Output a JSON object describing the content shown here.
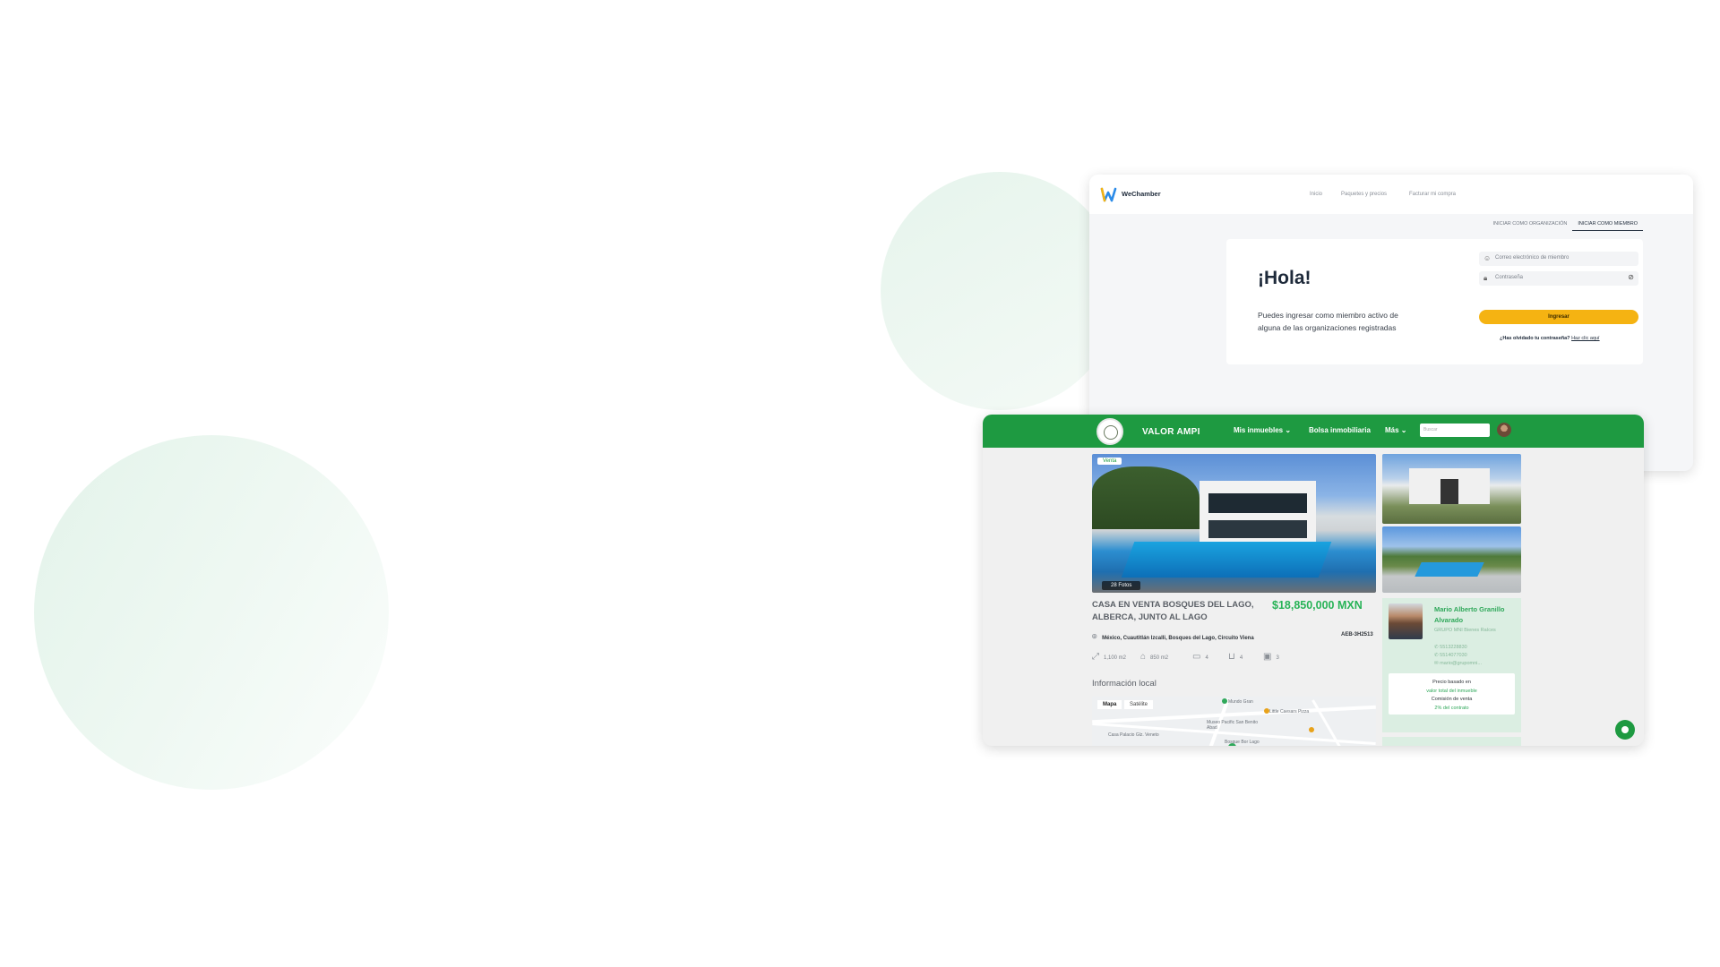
{
  "wechamber": {
    "brand": "WeChamber",
    "nav": [
      "Inicio",
      "Paquetes y precios",
      "Facturar mi compra"
    ],
    "tabs": [
      "INICIAR COMO ORGANIZACIÓN",
      "INICIAR COMO MIEMBRO"
    ],
    "active_tab": "INICIAR COMO MIEMBRO",
    "greeting": "¡Hola!",
    "description": "Puedes ingresar como miembro activo de alguna de las organizaciones registradas",
    "email_placeholder": "Correo electrónico de miembro",
    "password_placeholder": "Contraseña",
    "login_button": "Ingresar",
    "forgot_text": "¿Has olvidado tu contraseña?",
    "forgot_link": "Haz clic aquí",
    "colors": {
      "accent": "#f5b312",
      "text": "#1e2a3a"
    }
  },
  "valor": {
    "brand": "VALOR AMPI",
    "nav": {
      "mis_inmuebles": "Mis inmuebles",
      "bolsa": "Bolsa inmobiliaria",
      "mas": "Más"
    },
    "search_placeholder": "Buscar",
    "listing": {
      "tag": "Venta",
      "photo_count": "28 Fotos",
      "title": "CASA EN VENTA BOSQUES DEL LAGO, ALBERCA, JUNTO AL LAGO",
      "price": "$18,850,000 MXN",
      "location": "México, Cuautitlán Izcalli, Bosques del Lago, Circuito Viena",
      "code": "AEB-3H2513",
      "features": [
        "1,100 m2",
        "850 m2",
        "4",
        "4",
        "3"
      ]
    },
    "info_heading": "Información local",
    "map": {
      "tabs": [
        "Mapa",
        "Satélite"
      ],
      "labels": [
        "Mundo Gran",
        "Little Caesars Pizza",
        "Museo Pacific San Benito Abad",
        "Casa Palacio Glz. Veneto",
        "Bosque Bor Lago"
      ]
    },
    "agent": {
      "name": "Mario Alberto Granillo Alvarado",
      "org": "GRUPO MNI Bienes Raíces",
      "phone1": "5513228830",
      "phone2": "5514077030",
      "email": "mario@grupomni..."
    },
    "commission": {
      "line1": "Precio basado en",
      "line2": "valor total del inmueble",
      "line3": "Comisión de venta",
      "line4": "2% del contrato"
    },
    "colors": {
      "primary": "#1e9a41",
      "price": "#28b357"
    }
  },
  "icons": [
    "wechamber-logo-icon",
    "user-icon",
    "lock-icon",
    "eye-off-icon",
    "chevron-down-icon",
    "map-pin-icon",
    "resize-icon",
    "house-icon",
    "bed-icon",
    "bath-icon",
    "parking-icon",
    "phone-icon",
    "mail-icon",
    "chat-icon"
  ]
}
